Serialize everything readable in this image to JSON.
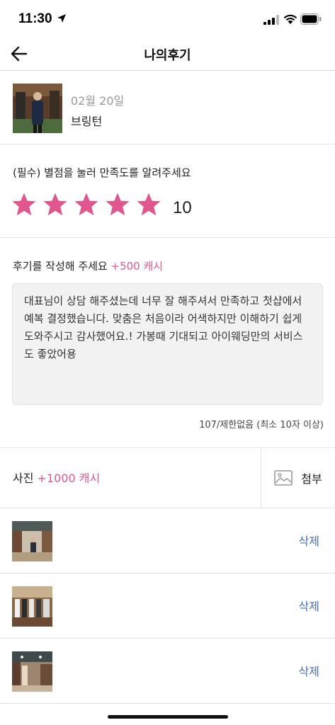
{
  "status_bar": {
    "time": "11:30"
  },
  "header": {
    "title": "나의후기"
  },
  "product": {
    "date": "02월 20일",
    "name": "브링턴"
  },
  "rating": {
    "label": "(필수) 별점을 눌러 만족도를 알려주세요",
    "stars_filled": 5,
    "stars_total": 5,
    "score": "10",
    "star_color": "#e0568e"
  },
  "review": {
    "label": "후기를 작성해 주세요",
    "bonus": "+500 캐시",
    "text": "대표님이 상담 해주셨는데 너무 잘 해주셔서 만족하고 첫샵에서 예복 결정했습니다. 맞춤은 처음이라 어색하지만 이해하기 쉽게 도와주시고 감사했어요.! 가봉때 기대되고 아이웨딩만의 서비스도 좋았어용",
    "char_count": "107/제한없음 (최소 10자 이상)"
  },
  "photo": {
    "label": "사진",
    "bonus": "+1000 캐시",
    "attach_label": "첨부"
  },
  "photos": [
    {
      "delete_label": "삭제"
    },
    {
      "delete_label": "삭제"
    },
    {
      "delete_label": "삭제"
    }
  ],
  "colors": {
    "accent": "#e0568e",
    "link": "#4a6fb5"
  }
}
